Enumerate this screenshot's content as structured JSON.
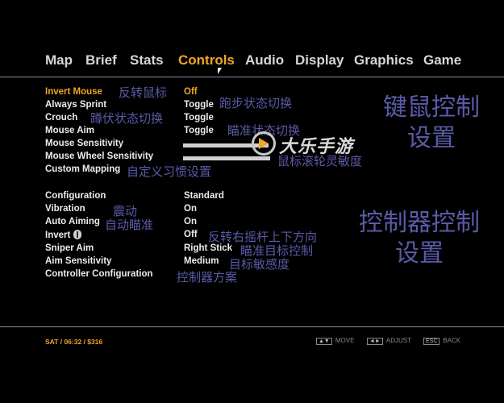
{
  "tabs": [
    "Map",
    "Brief",
    "Stats",
    "Controls",
    "Audio",
    "Display",
    "Graphics",
    "Game"
  ],
  "active_tab": "Controls",
  "settings_group1": [
    {
      "label": "Invert Mouse",
      "value": "Off",
      "annotation": "反转鼠标"
    },
    {
      "label": "Always Sprint",
      "value": "Toggle",
      "annotation": "跑步状态切换"
    },
    {
      "label": "Crouch",
      "value": "Toggle",
      "annotation": "蹲伏状态切换"
    },
    {
      "label": "Mouse Aim",
      "value": "Toggle",
      "annotation": "瞄准状态切换"
    },
    {
      "label": "Mouse Sensitivity",
      "slider_level": 0.33
    },
    {
      "label": "Mouse Wheel Sensitivity",
      "slider_level": 0.37,
      "annotation": "鼠标滚轮灵敏度"
    },
    {
      "label": "Custom Mapping",
      "annotation": "自定义习惯设置"
    }
  ],
  "settings_group2": [
    {
      "label": "Configuration",
      "value": "Standard"
    },
    {
      "label": "Vibration",
      "value": "On",
      "annotation": "震动"
    },
    {
      "label": "Auto Aiming",
      "value": "On",
      "annotation": "自动瞄准"
    },
    {
      "label": "Invert",
      "value": "Off",
      "annotation": "反转右摇杆上下方向"
    },
    {
      "label": "Sniper Aim",
      "value": "Right Stick",
      "annotation": "瞄准目标控制"
    },
    {
      "label": "Aim Sensitivity",
      "value": "Medium",
      "annotation": "目标敏感度"
    },
    {
      "label": "Controller Configuration",
      "annotation": "控制器方案"
    }
  ],
  "big_labels": {
    "keyboard_mouse": "键鼠控制\n设置",
    "controller": "控制器控制\n设置"
  },
  "watermark": "大乐手游",
  "status": "SAT  /  06:32  /  $316",
  "hints": [
    {
      "keys": "▲▼",
      "label": "MOVE"
    },
    {
      "keys": "◄►",
      "label": "ADJUST"
    },
    {
      "keys": "ESC",
      "label": "BACK"
    }
  ],
  "colors": {
    "accent": "#f0a628",
    "annotation": "#5a5aa8",
    "text": "#ececec",
    "background": "#000000"
  }
}
